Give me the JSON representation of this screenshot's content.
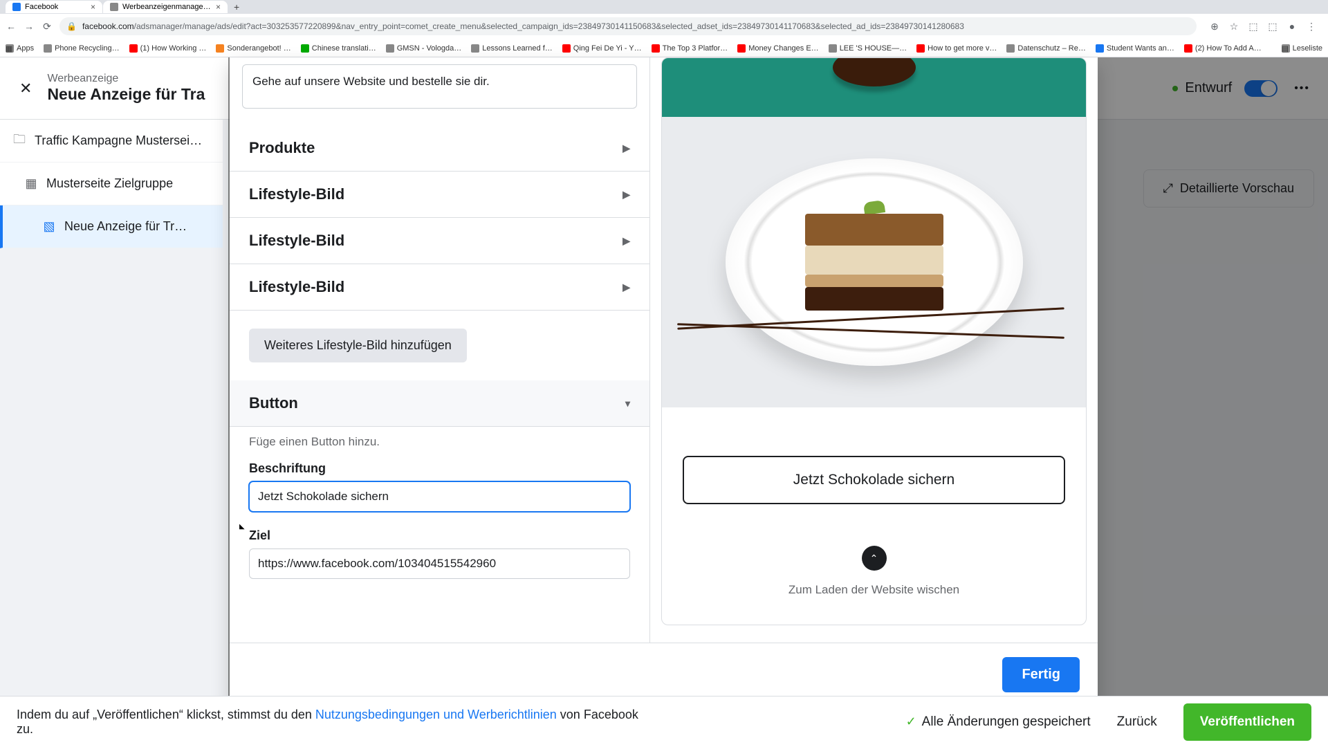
{
  "browser": {
    "tabs": [
      {
        "label": "Facebook"
      },
      {
        "label": "Werbeanzeigenmanager - We…"
      }
    ],
    "url_domain": "facebook.com",
    "url_path": "/adsmanager/manage/ads/edit?act=303253577220899&nav_entry_point=comet_create_menu&selected_campaign_ids=23849730141150683&selected_adset_ids=23849730141170683&selected_ad_ids=23849730141280683",
    "bookmarks": [
      "Apps",
      "Phone Recycling…",
      "(1) How Working …",
      "Sonderangebot! …",
      "Chinese translati…",
      "GMSN - Vologda…",
      "Lessons Learned f…",
      "Qing Fei De Yi - Y…",
      "The Top 3 Platfor…",
      "Money Changes E…",
      "LEE 'S HOUSE—…",
      "How to get more v…",
      "Datenschutz – Re…",
      "Student Wants an…",
      "(2) How To Add A…"
    ],
    "reading_list": "Leseliste"
  },
  "header": {
    "sup": "Werbeanzeige",
    "main": "Neue Anzeige für Tra",
    "draft": "Entwurf"
  },
  "nav": {
    "campaign": "Traffic Kampagne Mustersei…",
    "adset": "Musterseite Zielgruppe",
    "ad": "Neue Anzeige für Tr…"
  },
  "preview_button": "Detaillierte Vorschau",
  "modal": {
    "textarea": "Gehe auf unsere Website und bestelle sie dir.",
    "sections": [
      "Produkte",
      "Lifestyle-Bild",
      "Lifestyle-Bild",
      "Lifestyle-Bild"
    ],
    "add_lifestyle": "Weiteres Lifestyle-Bild hinzufügen",
    "button_heading": "Button",
    "button_helper": "Füge einen Button hinzu.",
    "label_caption": "Beschriftung",
    "caption_value": "Jetzt Schokolade sichern",
    "label_target": "Ziel",
    "target_value": "https://www.facebook.com/103404515542960",
    "cta_preview": "Jetzt Schokolade sichern",
    "swipe_text": "Zum Laden der Website wischen",
    "done": "Fertig"
  },
  "footer": {
    "text_pieces": [
      "Indem du auf „Veröffentlichen“ klickst, stimmst du den ",
      "Nutzungsbedingungen und Werberichtlinien",
      " von Facebook zu."
    ],
    "saved": "Alle Änderungen gespeichert",
    "back": "Zurück",
    "publish": "Veröffentlichen"
  }
}
